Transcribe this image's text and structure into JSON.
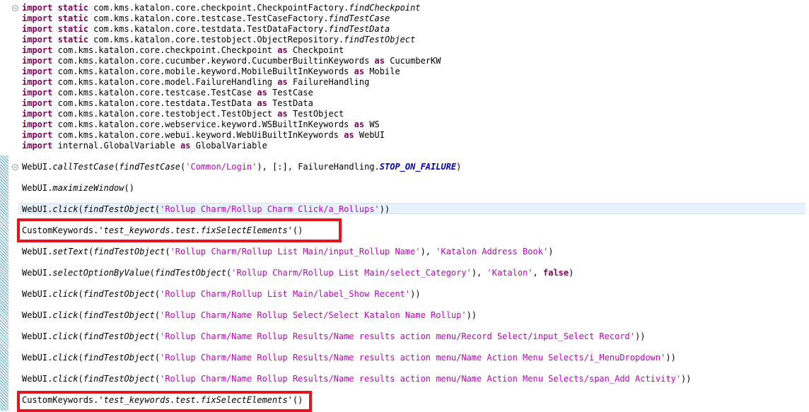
{
  "imports": [
    {
      "kw": "import static",
      "pkg": "com.kms.katalon.core.checkpoint.CheckpointFactory.",
      "member": "findCheckpoint"
    },
    {
      "kw": "import static",
      "pkg": "com.kms.katalon.core.testcase.TestCaseFactory.",
      "member": "findTestCase"
    },
    {
      "kw": "import static",
      "pkg": "com.kms.katalon.core.testdata.TestDataFactory.",
      "member": "findTestData"
    },
    {
      "kw": "import static",
      "pkg": "com.kms.katalon.core.testobject.ObjectRepository.",
      "member": "findTestObject"
    },
    {
      "kw": "import",
      "pkg": "com.kms.katalon.core.checkpoint.Checkpoint",
      "as": "as",
      "alias": "Checkpoint"
    },
    {
      "kw": "import",
      "pkg": "com.kms.katalon.core.cucumber.keyword.CucumberBuiltinKeywords",
      "as": "as",
      "alias": "CucumberKW"
    },
    {
      "kw": "import",
      "pkg": "com.kms.katalon.core.mobile.keyword.MobileBuiltInKeywords",
      "as": "as",
      "alias": "Mobile"
    },
    {
      "kw": "import",
      "pkg": "com.kms.katalon.core.model.FailureHandling",
      "as": "as",
      "alias": "FailureHandling"
    },
    {
      "kw": "import",
      "pkg": "com.kms.katalon.core.testcase.TestCase",
      "as": "as",
      "alias": "TestCase"
    },
    {
      "kw": "import",
      "pkg": "com.kms.katalon.core.testdata.TestData",
      "as": "as",
      "alias": "TestData"
    },
    {
      "kw": "import",
      "pkg": "com.kms.katalon.core.testobject.TestObject",
      "as": "as",
      "alias": "TestObject"
    },
    {
      "kw": "import",
      "pkg": "com.kms.katalon.core.webservice.keyword.WSBuiltInKeywords",
      "as": "as",
      "alias": "WS"
    },
    {
      "kw": "import",
      "pkg": "com.kms.katalon.core.webui.keyword.WebUiBuiltInKeywords",
      "as": "as",
      "alias": "WebUI"
    },
    {
      "kw": "import",
      "pkg": "internal.GlobalVariable",
      "as": "as",
      "alias": "GlobalVariable"
    }
  ],
  "statements": {
    "s1": {
      "obj": "WebUI.",
      "method": "callTestCase",
      "open": "(",
      "fn": "findTestCase",
      "arg": "'Common/Login'",
      "rest": "), [:], FailureHandling.",
      "const": "STOP_ON_FAILURE",
      "close": ")"
    },
    "s2": {
      "obj": "WebUI.",
      "method": "maximizeWindow",
      "close": "()"
    },
    "s3": {
      "obj": "WebUI.",
      "method": "click",
      "open": "(",
      "fn": "findTestObject",
      "arg": "'Rollup Charm/Rollup Charm Click/a_Rollups'",
      "close": "))"
    },
    "s4": {
      "obj": "CustomKeywords.",
      "method": "'test_keywords.test.fixSelectElements'",
      "close": "()"
    },
    "s5": {
      "obj": "WebUI.",
      "method": "setText",
      "open": "(",
      "fn": "findTestObject",
      "arg": "'Rollup Charm/Rollup List Main/input_Rollup Name'",
      "mid": "), ",
      "arg2": "'Katalon Address Book'",
      "close": ")"
    },
    "s6": {
      "obj": "WebUI.",
      "method": "selectOptionByValue",
      "open": "(",
      "fn": "findTestObject",
      "arg": "'Rollup Charm/Rollup List Main/select_Category'",
      "mid": "), ",
      "arg2": "'Katalon'",
      "mid2": ", ",
      "kw2": "false",
      "close": ")"
    },
    "s7": {
      "obj": "WebUI.",
      "method": "click",
      "open": "(",
      "fn": "findTestObject",
      "arg": "'Rollup Charm/Rollup List Main/label_Show Recent'",
      "close": "))"
    },
    "s8": {
      "obj": "WebUI.",
      "method": "click",
      "open": "(",
      "fn": "findTestObject",
      "arg": "'Rollup Charm/Name Rollup Select/Select Katalon Name Rollup'",
      "close": "))"
    },
    "s9": {
      "obj": "WebUI.",
      "method": "click",
      "open": "(",
      "fn": "findTestObject",
      "arg": "'Rollup Charm/Name Rollup Results/Name results action menu/Record Select/input_Select Record'",
      "close": "))"
    },
    "s10": {
      "obj": "WebUI.",
      "method": "click",
      "open": "(",
      "fn": "findTestObject",
      "arg": "'Rollup Charm/Name Rollup Results/Name results action menu/Name Action Menu Selects/i_MenuDropdown'",
      "close": "))"
    },
    "s11": {
      "obj": "WebUI.",
      "method": "click",
      "open": "(",
      "fn": "findTestObject",
      "arg": "'Rollup Charm/Name Rollup Results/Name results action menu/Name Action Menu Selects/span_Add Activity'",
      "close": "))"
    },
    "s12": {
      "obj": "CustomKeywords.",
      "method": "'test_keywords.test.fixSelectElements'",
      "close": "()"
    }
  },
  "colors": {
    "keyword": "#7f0055",
    "string": "#c000c0",
    "constant": "#0000c0",
    "highlight": "#e3151f"
  }
}
